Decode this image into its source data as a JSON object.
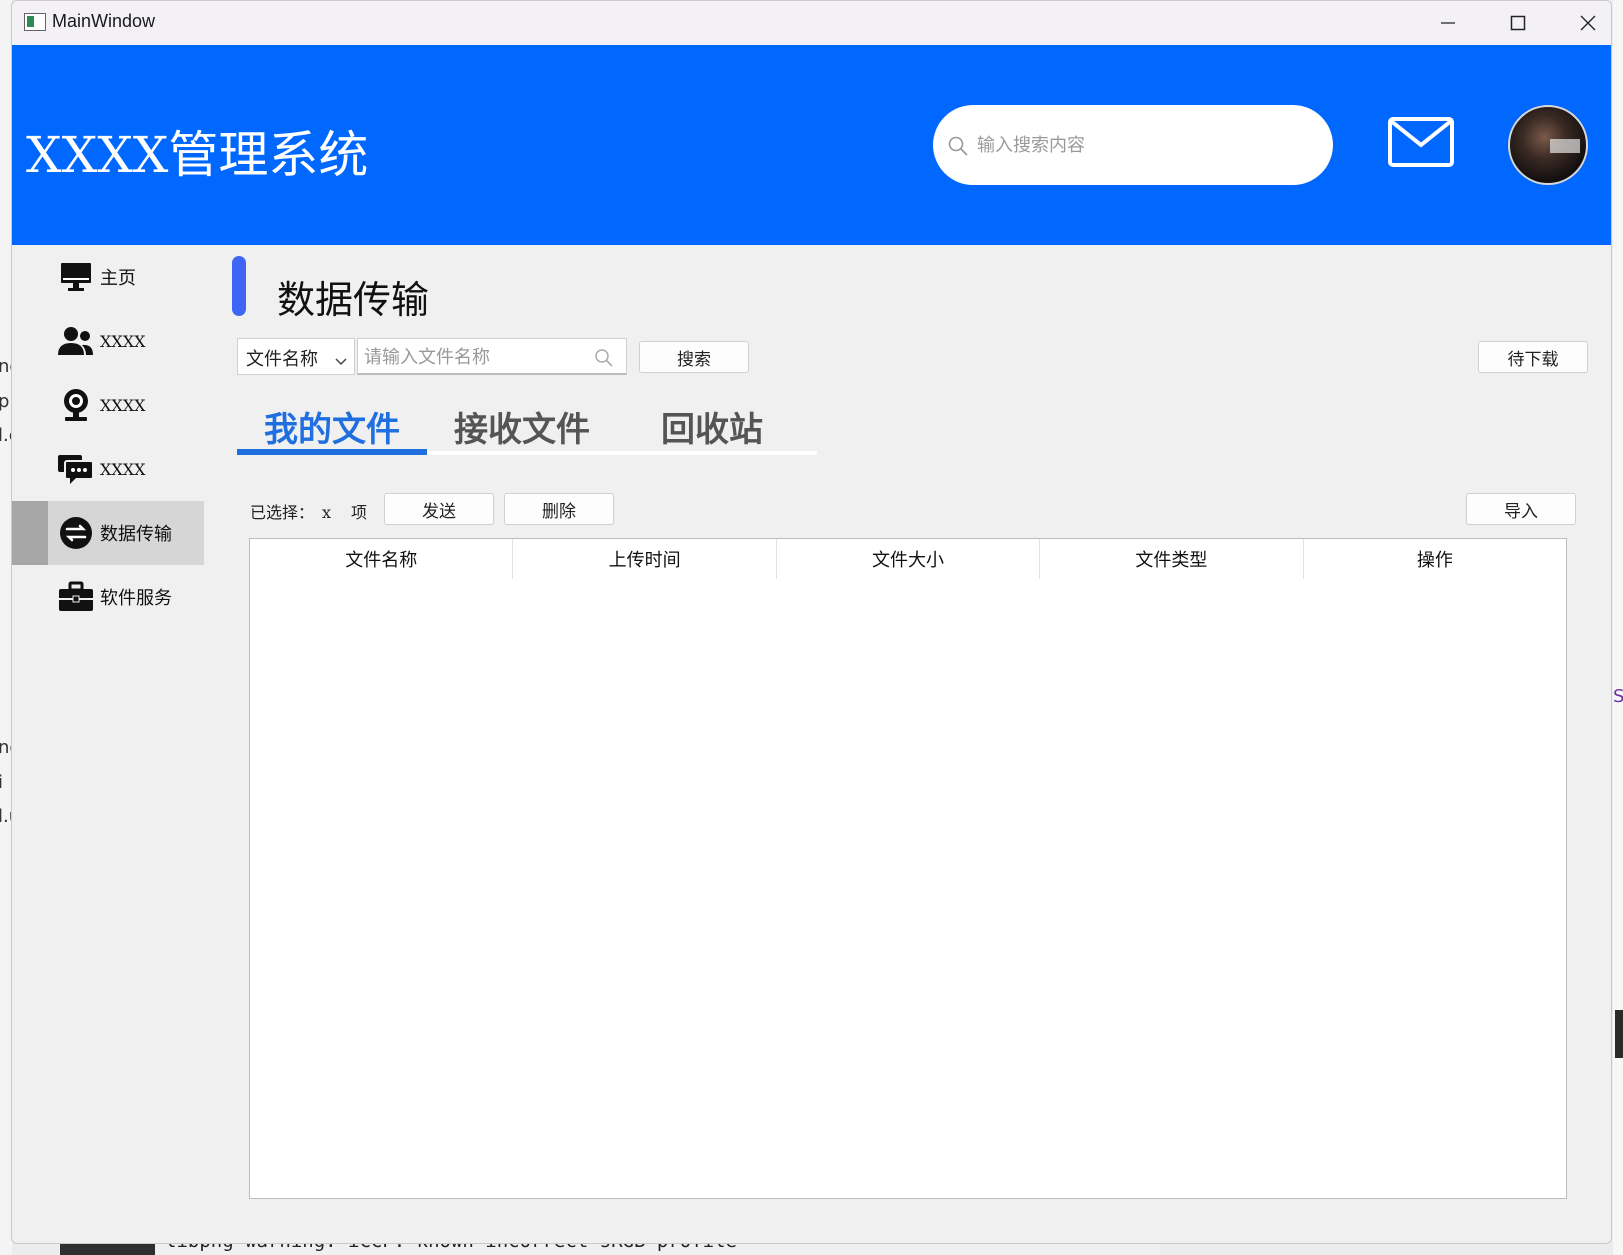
{
  "window": {
    "title": "MainWindow"
  },
  "header": {
    "app_title": "XXXX管理系统",
    "search_placeholder": "输入搜索内容"
  },
  "sidebar": {
    "items": [
      {
        "label": "主页",
        "icon": "monitor-icon"
      },
      {
        "label": "XXXX",
        "icon": "users-icon"
      },
      {
        "label": "XXXX",
        "icon": "webcam-icon"
      },
      {
        "label": "XXXX",
        "icon": "chat-icon"
      },
      {
        "label": "数据传输",
        "icon": "transfer-icon",
        "active": true
      },
      {
        "label": "软件服务",
        "icon": "briefcase-icon"
      }
    ]
  },
  "main": {
    "page_title": "数据传输",
    "filter": {
      "selected": "文件名称",
      "placeholder": "请输入文件名称"
    },
    "search_button": "搜索",
    "pending_button": "待下载",
    "tabs": [
      {
        "label": "我的文件",
        "active": true
      },
      {
        "label": "接收文件"
      },
      {
        "label": "回收站"
      }
    ],
    "selection": {
      "prefix": "已选择：",
      "count": "x",
      "suffix": "项"
    },
    "send_button": "发送",
    "delete_button": "删除",
    "import_button": "导入",
    "table": {
      "columns": [
        "文件名称",
        "上传时间",
        "文件大小",
        "文件类型",
        "操作"
      ],
      "rows": []
    }
  },
  "background": {
    "left_fragments": [
      "ne",
      "p",
      "l.c",
      "ne",
      "i",
      "l.u"
    ],
    "right_fragment": "S",
    "console_line": "libpng warning: iCCP: known incorrect sRGB profile"
  },
  "colors": {
    "header_bg": "#0067ff",
    "accent": "#1f6fe0",
    "page_marker": "#3d66f5"
  }
}
